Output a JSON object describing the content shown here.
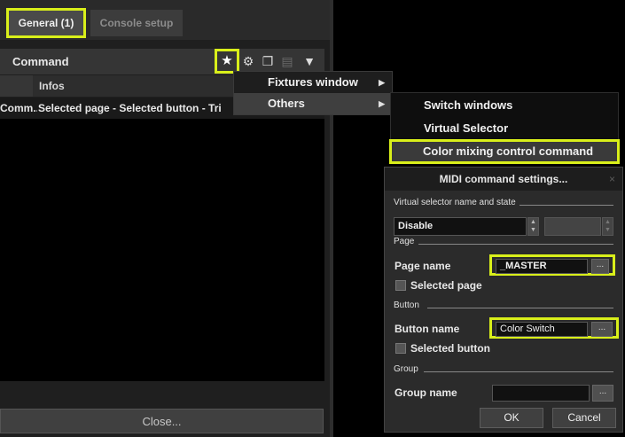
{
  "tabs": [
    {
      "label": "General (1)",
      "active": true
    },
    {
      "label": "Console setup",
      "active": false
    }
  ],
  "list_header": {
    "title": "Command",
    "infos_label": "Infos"
  },
  "toolbar_icons": [
    "star-icon",
    "gear-icon",
    "copy-icon",
    "page-icon",
    "cup-icon"
  ],
  "list_row": {
    "command": "Comm...",
    "infos": "Selected page - Selected button - Tri"
  },
  "close_button": "Close...",
  "context_menu": {
    "items": [
      {
        "label": "Fixtures window",
        "arrow": "▶"
      },
      {
        "label": "Others",
        "arrow": "▶"
      }
    ]
  },
  "submenu": {
    "items": [
      "Switch windows",
      "Virtual Selector",
      "Color mixing control command"
    ]
  },
  "dialog": {
    "title": "MIDI command settings...",
    "close_glyph": "×",
    "section_virtual": "Virtual selector name and state",
    "vs_state": "Disable",
    "section_page": "Page",
    "page_name_label": "Page name",
    "page_name_value": "_MASTER",
    "browse": "...",
    "selected_page_label": "Selected page",
    "section_button": "Button",
    "button_name_label": "Button name",
    "button_name_value": "Color Switch",
    "selected_button_label": "Selected button",
    "section_group": "Group",
    "group_name_label": "Group name",
    "group_name_value": "",
    "ok": "OK",
    "cancel": "Cancel"
  },
  "colors": {
    "highlight": "#d9ef1a",
    "panel": "#1f1f1f",
    "menu_active": "#3f3f3f"
  }
}
